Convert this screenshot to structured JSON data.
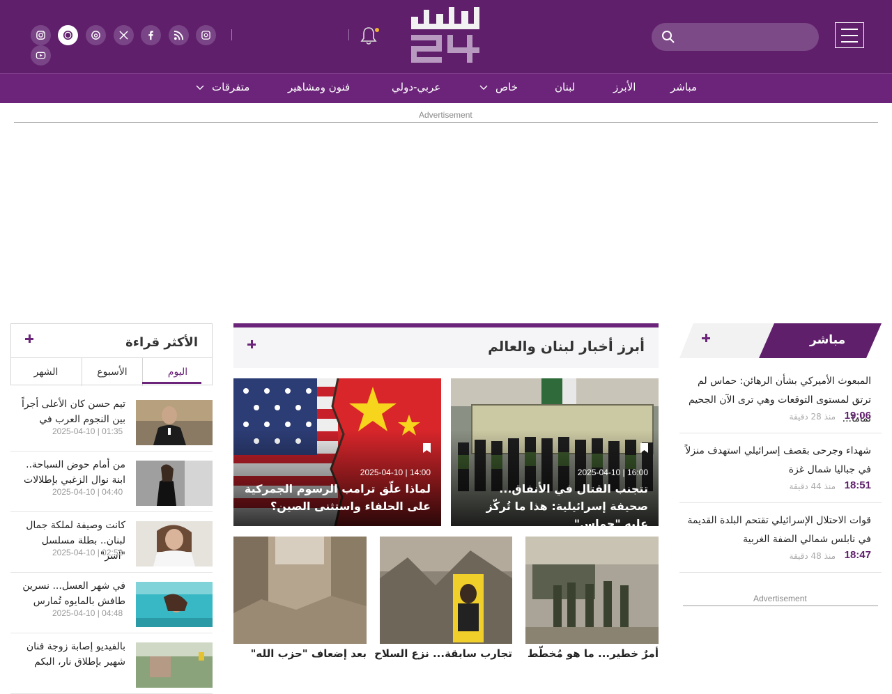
{
  "header": {
    "logo_alt": "لبنان 24",
    "nav": [
      "مباشر",
      "الأبرز",
      "لبنان",
      "خاص",
      "عربي-دولي",
      "فنون ومشاهير",
      "متفرقات"
    ],
    "social_icons": [
      "instagram-icon",
      "whatsapp-icon",
      "threads-icon",
      "x-icon",
      "facebook-icon",
      "rss-icon",
      "podcast-icon",
      "youtube-icon"
    ]
  },
  "ads": {
    "label": "Advertisement"
  },
  "most_read": {
    "title": "الأكثر قراءة",
    "tabs": [
      "اليوم",
      "الأسبوع",
      "الشهر"
    ],
    "items": [
      {
        "title": "تيم حسن كان الأعلى أجراً بين النجوم العرب في",
        "date": "2025-04-10 | 01:35"
      },
      {
        "title": "من أمام حوض السباحة.. ابنة نوال الزغبي بإطلالات",
        "date": "2025-04-10 | 04:40"
      },
      {
        "title": "كانت وصيفة لملكة جمال لبنان.. بطلة مسلسل \"آسر\"",
        "date": "2025-04-10 | 02:52"
      },
      {
        "title": "في شهر العسل... نسرين طافش بالمايوه تُمارس",
        "date": "2025-04-10 | 04:48"
      },
      {
        "title": "بالفيديو إصابة زوجة فنان شهير بإطلاق نار، البكم",
        "date": ""
      }
    ]
  },
  "center": {
    "title": "أبرز أخبار لبنان والعالم",
    "big_cards": [
      {
        "title": "تتجنب القتال في الأنفاق... صحيفة إسرائيلية: هذا ما تُركّز عليه \"حماس\"",
        "date": "2025-04-10 | 16:00"
      },
      {
        "title": "لماذا علّق ترامب الرسوم الجمركية على الحلفاء واستثنى الصين؟",
        "date": "2025-04-10 | 14:00"
      }
    ],
    "small_cards": [
      {
        "title": "أمرٌ خطير... ما هو مُخطّط"
      },
      {
        "title": "تجارب سابقة... نزع السلاح"
      },
      {
        "title": "بعد إضعاف \"حزب الله\""
      }
    ]
  },
  "live": {
    "title": "مباشر",
    "items": [
      {
        "title": "المبعوث الأميركي بشأن الرهائن: حماس لم ترتق لمستوى التوقعات وهي ترى الآن الجحيم تماما...",
        "time": "19:06",
        "ago": "منذ 28 دقيقة"
      },
      {
        "title": "شهداء وجرحى بقصف إسرائيلي استهدف منزلاً في جباليا شمال غزة",
        "time": "18:51",
        "ago": "منذ 44 دقيقة"
      },
      {
        "title": "قوات الاحتلال الإسرائيلي تقتحم البلدة القديمة في نابلس شمالي الضفة الغربية",
        "time": "18:47",
        "ago": "منذ 48 دقيقة"
      }
    ]
  },
  "colors": {
    "brand": "#5f1f6b",
    "nav": "#6b2479",
    "notification": "#f2b531"
  }
}
